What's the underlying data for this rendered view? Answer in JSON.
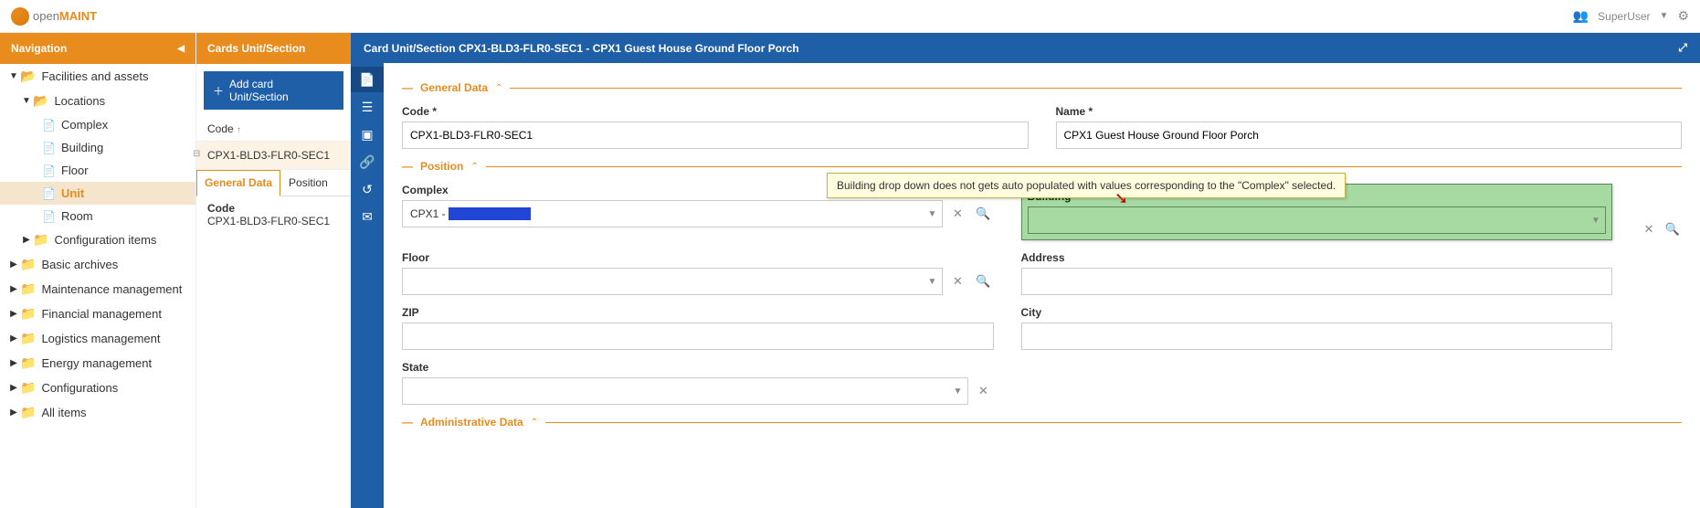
{
  "topbar": {
    "logo_open": "open",
    "logo_maint": "MAINT",
    "user": "SuperUser"
  },
  "nav": {
    "title": "Navigation",
    "items": {
      "facilities": "Facilities and assets",
      "locations": "Locations",
      "complex": "Complex",
      "building": "Building",
      "floor": "Floor",
      "unit": "Unit",
      "room": "Room",
      "config_items": "Configuration items",
      "basic_archives": "Basic archives",
      "maintenance": "Maintenance management",
      "financial": "Financial management",
      "logistics": "Logistics management",
      "energy": "Energy management",
      "configurations": "Configurations",
      "all_items": "All items"
    }
  },
  "cards": {
    "title": "Cards Unit/Section",
    "add_label": "Add card Unit/Section",
    "col_code": "Code",
    "row_code": "CPX1-BLD3-FLR0-SEC1",
    "tab_general": "General Data",
    "tab_position": "Position",
    "detail_label": "Code",
    "detail_value": "CPX1-BLD3-FLR0-SEC1"
  },
  "card": {
    "title": "Card Unit/Section CPX1-BLD3-FLR0-SEC1 - CPX1 Guest House Ground Floor Porch",
    "sections": {
      "general": "General Data",
      "position": "Position",
      "admin": "Administrative Data"
    },
    "fields": {
      "code_label": "Code *",
      "code_value": "CPX1-BLD3-FLR0-SEC1",
      "name_label": "Name *",
      "name_value": "CPX1 Guest House Ground Floor Porch",
      "complex_label": "Complex",
      "complex_value": "CPX1 - ",
      "building_label": "Building",
      "building_value": "",
      "floor_label": "Floor",
      "floor_value": "",
      "address_label": "Address",
      "address_value": "",
      "zip_label": "ZIP",
      "zip_value": "",
      "city_label": "City",
      "city_value": "",
      "state_label": "State",
      "state_value": ""
    },
    "callout": "Building drop down does not gets auto populated with values corresponding to the \"Complex\" selected."
  }
}
